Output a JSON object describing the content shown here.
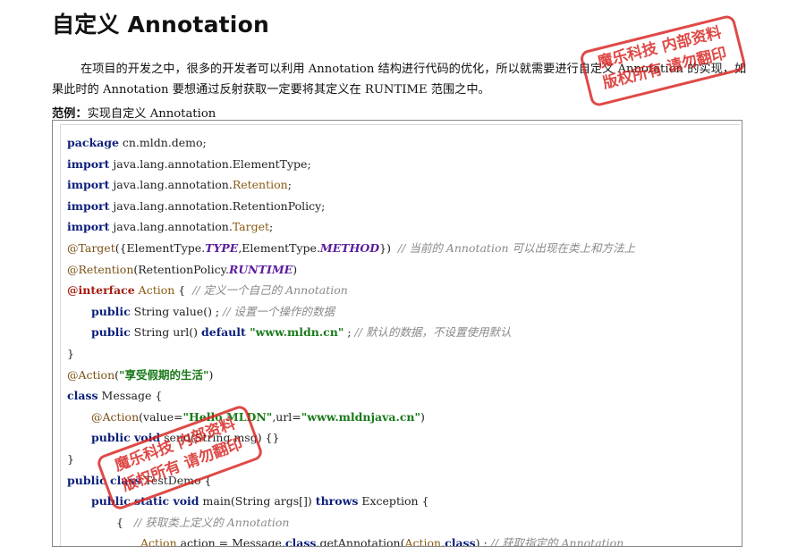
{
  "title": "自定义 Annotation",
  "paragraph": {
    "line1": "在项目的开发之中，很多的开发者可以利用 Annotation 结构进行代码的优化，所以就需要进行自定义 Annotation 的实现，如",
    "line2": "果此时的 Annotation 要想通过反射获取一定要将其定义在 RUNTIME 范围之中。"
  },
  "example": {
    "label": "范例：",
    "text": "实现自定义 Annotation"
  },
  "code": {
    "l1_kw": "package",
    "l1_rest": " cn.mldn.demo;",
    "l2_kw": "import",
    "l2_rest": " java.lang.annotation.ElementType;",
    "l3_kw": "import",
    "l3_a": " java.lang.annotation.",
    "l3_cls": "Retention",
    "l3_end": ";",
    "l4_kw": "import",
    "l4_rest": " java.lang.annotation.RetentionPolicy;",
    "l5_kw": "import",
    "l5_a": " java.lang.annotation.",
    "l5_cls": "Target",
    "l5_end": ";",
    "l6_ann": "@Target",
    "l6_a": "({ElementType.",
    "l6_c1": "TYPE",
    "l6_b": ",ElementType.",
    "l6_c2": "METHOD",
    "l6_end": "})",
    "l6_cmt": "  // 当前的 Annotation 可以出现在类上和方法上",
    "l7_ann": "@Retention",
    "l7_a": "(RetentionPolicy.",
    "l7_c": "RUNTIME",
    "l7_end": ")",
    "l8_red": "@interface",
    "l8_cls": " Action",
    "l8_a": " {",
    "l8_cmt": "  // 定义一个自己的 Annotation",
    "l9_kw": "public",
    "l9_a": " String value() ;",
    "l9_cmt": " // 设置一个操作的数据",
    "l10_kw": "public",
    "l10_a": " String url() ",
    "l10_kw2": "default",
    "l10_str": " \"www.mldn.cn\"",
    "l10_b": " ;",
    "l10_cmt": " // 默认的数据，不设置使用默认",
    "l11": "}",
    "l12_ann": "@Action",
    "l12_a": "(",
    "l12_str": "\"享受假期的生活\"",
    "l12_end": ")",
    "l13_kw": "class",
    "l13_rest": " Message {",
    "l14_ann": "@Action",
    "l14_a": "(value=",
    "l14_str1": "\"Hello MLDN\"",
    "l14_b": ",url=",
    "l14_str2": "\"www.mldnjava.cn\"",
    "l14_end": ")",
    "l15_kw": "public",
    "l15_kw2": " void",
    "l15_rest": " send(String msg) {}",
    "l16": "}",
    "l17_kw": "public",
    "l17_kw2": " class",
    "l17_rest": " TestDemo {",
    "l18_kw": "public",
    "l18_kw2": " static",
    "l18_kw3": " void",
    "l18_a": " main(String args[]) ",
    "l18_kw4": "throws",
    "l18_rest": " Exception {",
    "l19_a": "{",
    "l19_cmt": "   // 获取类上定义的 Annotation",
    "l20_cls1": "Action",
    "l20_a": " action = Message.",
    "l20_kw": "class",
    "l20_b": ".getAnnotation(",
    "l20_cls2": "Action",
    "l20_c": ".",
    "l20_kw2": "class",
    "l20_d": ") ;",
    "l20_cmt": " // 获取指定的 Annotation"
  },
  "watermark": {
    "line1": "魔乐科技 内部资料",
    "line2": "版权所有 请勿翻印"
  },
  "colors": {
    "stamp": "#d8231f",
    "keyword": "#0b1f7a",
    "string": "#1a7a1a",
    "comment": "#8a8a8a"
  }
}
